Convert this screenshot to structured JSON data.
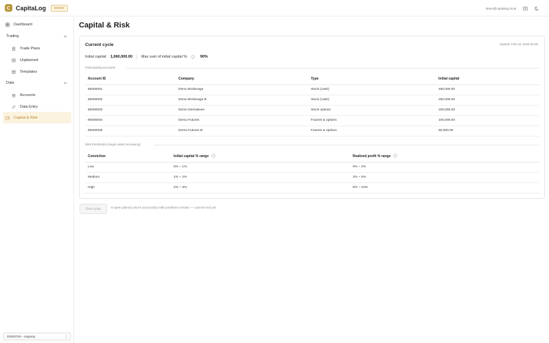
{
  "app": {
    "name": "CapitaLog",
    "badge": "DEMO",
    "user_email": "demo@capitalog.local",
    "accent": "#b8963a"
  },
  "sidebar": {
    "dashboard": "Dashboard",
    "trading_group": "Trading",
    "trade_plans": "Trade Plans",
    "unplanned": "Unplanned",
    "templates": "Templates",
    "data_group": "Data",
    "accounts": "Accounts",
    "data_entry": "Data Entry",
    "capital_risk": "Capital & Risk",
    "cycle_select": "2026/2/18 – ongoing"
  },
  "main": {
    "title": "Capital & Risk",
    "current_cycle": "Current cycle",
    "started": "Started: Feb 18, 2026 00:00",
    "initial_capital_label": "Initial capital:",
    "initial_capital_value": "1,060,000.00",
    "max_sum_label": "Max sum of initial capital %:",
    "max_sum_value": "90%",
    "participating_label": "Participating accounts",
    "accounts_table": {
      "headers": [
        "Account ID",
        "Company",
        "Type",
        "Initial capital"
      ],
      "rows": [
        [
          "80000001",
          "Demo Brokerage",
          "Stock (cash)",
          "450,000.00"
        ],
        [
          "80000002",
          "Demo Brokerage B",
          "Stock (cash)",
          "250,000.00"
        ],
        [
          "80000003",
          "Demo Derivatives",
          "Stock options",
          "200,000.00"
        ],
        [
          "80000004",
          "Demo Futures",
          "Futures & options",
          "100,000.00"
        ],
        [
          "80000005",
          "Demo Futures B",
          "Futures & options",
          "60,000.00"
        ]
      ]
    },
    "risk_label": "Risk thresholds (single-sided increasing)",
    "risk_table": {
      "headers": [
        "Conviction",
        "Initial capital % range",
        "Realized profit % range"
      ],
      "rows": [
        [
          "Low",
          "0% ~ 1%",
          "0% ~ 2%"
        ],
        [
          "Medium",
          "1% ~ 2%",
          "2% ~ 5%"
        ],
        [
          "High",
          "2% ~ 3%",
          "5% ~ 10%"
        ]
      ]
    },
    "end_cycle_button": "End cycle",
    "end_cycle_note": "6 open plan(s) and 5 account(s) with positions remain — cannot end yet"
  }
}
